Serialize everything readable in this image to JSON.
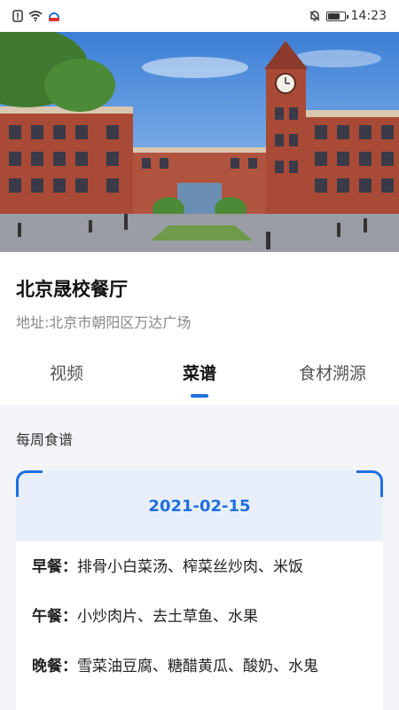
{
  "status_bar": {
    "time": "14:23",
    "icons": [
      "notification-alert-icon",
      "wifi-icon",
      "app-badge-icon",
      "mute-icon",
      "battery-icon"
    ],
    "battery_fraction": 0.8
  },
  "hero": {
    "description_icon": "school-building-image"
  },
  "restaurant": {
    "name": "北京晟校餐厅",
    "address": "地址:北京市朝阳区万达广场"
  },
  "tabs": [
    {
      "label": "视频",
      "active": false
    },
    {
      "label": "菜谱",
      "active": true
    },
    {
      "label": "食材溯源",
      "active": false
    }
  ],
  "menu": {
    "heading": "每周食谱",
    "date": "2021-02-15",
    "meals": [
      {
        "label": "早餐：",
        "items": "排骨小白菜汤、榨菜丝炒肉、米饭"
      },
      {
        "label": "午餐：",
        "items": "小炒肉片、去土草鱼、水果"
      },
      {
        "label": "晚餐：",
        "items": "雪菜油豆腐、糖醋黄瓜、酸奶、水鬼"
      }
    ]
  },
  "colors": {
    "accent": "#1f6fe0",
    "card_header_bg": "#e9effa",
    "page_bg": "#f2f4f8"
  }
}
